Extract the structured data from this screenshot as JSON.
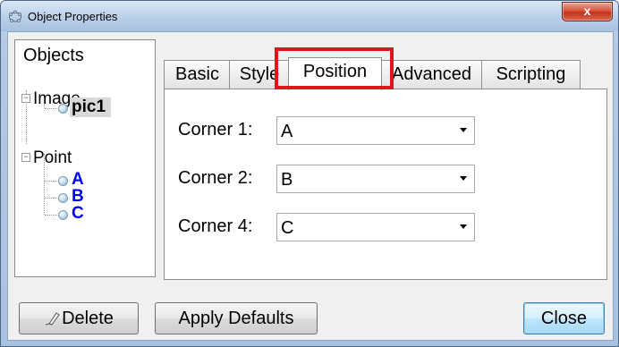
{
  "window": {
    "title": "Object Properties",
    "close_glyph": "x"
  },
  "tree": {
    "root_label": "Objects",
    "groups": [
      {
        "label": "Image",
        "expander": "−",
        "items": [
          {
            "label": "pic1",
            "color": "#000000",
            "selected": true
          }
        ]
      },
      {
        "label": "Point",
        "expander": "−",
        "items": [
          {
            "label": "A",
            "color": "#0000ff",
            "selected": false
          },
          {
            "label": "B",
            "color": "#0000ff",
            "selected": false
          },
          {
            "label": "C",
            "color": "#0000ff",
            "selected": false
          }
        ]
      }
    ]
  },
  "tabs": [
    {
      "label": "Basic",
      "active": false
    },
    {
      "label": "Style",
      "active": false
    },
    {
      "label": "Position",
      "active": true
    },
    {
      "label": "Advanced",
      "active": false
    },
    {
      "label": "Scripting",
      "active": false
    }
  ],
  "position": {
    "rows": [
      {
        "label": "Corner 1:",
        "value": "A"
      },
      {
        "label": "Corner 2:",
        "value": "B"
      },
      {
        "label": "Corner 4:",
        "value": "C"
      }
    ]
  },
  "buttons": {
    "delete": "Delete",
    "apply_defaults": "Apply Defaults",
    "close": "Close"
  },
  "colors": {
    "highlight": "#e0151b",
    "point_label": "#0000ff"
  },
  "icons": {
    "title": "geogebra-object-properties-icon",
    "delete": "eraser-icon",
    "tree_leaf": "bullet-icon"
  }
}
